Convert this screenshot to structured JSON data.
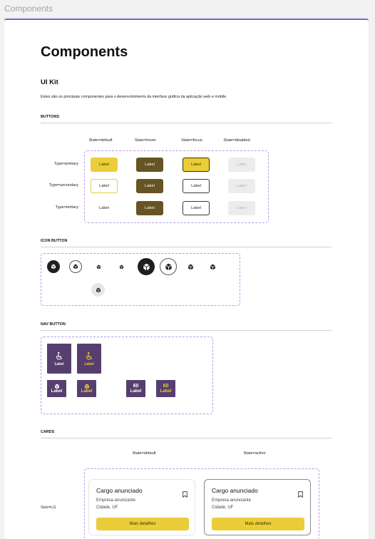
{
  "tab": {
    "title": "Components"
  },
  "page": {
    "title": "Components",
    "subtitle": "UI Kit",
    "description": "Estes são os principais componentes para o desenvolvimento da interface gráfica da aplicação web e mobile."
  },
  "buttons": {
    "section_title": "BUTTONS",
    "states": [
      "State=default",
      "State=hover",
      "State=focus",
      "State=disabled"
    ],
    "types": [
      "Type=primary",
      "Type=secondary",
      "Type=tertiary"
    ],
    "label": "Label"
  },
  "icon_button": {
    "section_title": "ICON BUTTON"
  },
  "nav_button": {
    "section_title": "NAV BUTTON",
    "label": "Label",
    "age_glyph": "60",
    "accent_color": "#563e6f"
  },
  "cards": {
    "section_title": "CARDS",
    "states": [
      "State=default",
      "State=active"
    ],
    "size_label": "Size=LG",
    "items": [
      {
        "title": "Cargo anunciado",
        "company": "Empresa anunciante",
        "city": "Cidade, UF",
        "cta": "Mais detalhes"
      },
      {
        "title": "Cargo anunciado",
        "company": "Empresa anunciante",
        "city": "Cidade, UF",
        "cta": "Mais detalhes"
      }
    ]
  },
  "colors": {
    "accent": "#8a5cd6",
    "primary_yellow": "#ebcd3a",
    "hover_brown": "#665424",
    "nav_purple": "#563e6f"
  },
  "icons": [
    "cube-icon",
    "wheelchair-icon",
    "bookmark-icon",
    "age-60-icon"
  ]
}
